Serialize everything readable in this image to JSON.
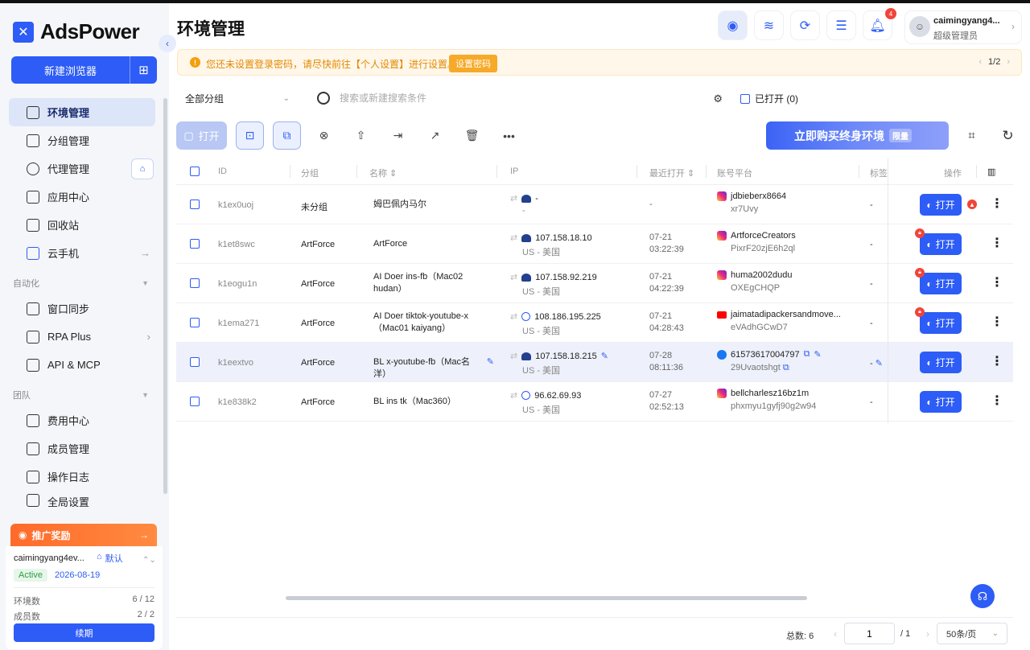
{
  "app": {
    "name": "AdsPower"
  },
  "sidebar": {
    "new_browser": "新建浏览器",
    "items": [
      {
        "label": "环境管理",
        "icon": "window-icon",
        "active": true
      },
      {
        "label": "分组管理",
        "icon": "folder-icon"
      },
      {
        "label": "代理管理",
        "icon": "globe-icon"
      },
      {
        "label": "应用中心",
        "icon": "puzzle-icon"
      },
      {
        "label": "回收站",
        "icon": "trash-icon"
      },
      {
        "label": "云手机",
        "icon": "cloud-phone-icon"
      }
    ],
    "section_automation": "自动化",
    "automation_items": [
      {
        "label": "窗口同步",
        "icon": "sync-icon"
      },
      {
        "label": "RPA Plus",
        "icon": "robot-icon"
      },
      {
        "label": "API & MCP",
        "icon": "api-icon"
      }
    ],
    "section_team": "团队",
    "team_items": [
      {
        "label": "费用中心",
        "icon": "wallet-icon"
      },
      {
        "label": "成员管理",
        "icon": "shield-user-icon"
      },
      {
        "label": "操作日志",
        "icon": "log-icon"
      },
      {
        "label": "全局设置",
        "icon": "settings-icon"
      }
    ],
    "promo": "推广奖励",
    "account": {
      "name": "caimingyang4ev...",
      "default_label": "默认",
      "status": "Active",
      "expiry": "2026-08-19",
      "env_label": "环境数",
      "env_value": "6 / 12",
      "member_label": "成员数",
      "member_value": "2 / 2",
      "renew": "续期"
    }
  },
  "header": {
    "title": "环境管理",
    "notification_count": "4",
    "user_name": "caimingyang4...",
    "user_role": "超级管理员"
  },
  "alert": {
    "text": "您还未设置登录密码，请尽快前往【个人设置】进行设置。",
    "button": "设置密码",
    "pager": "1/2"
  },
  "filters": {
    "group": "全部分组",
    "search_placeholder": "搜索或新建搜索条件",
    "opened": "已打开 (0)"
  },
  "toolbar": {
    "open": "打开",
    "buy_banner": "立即购买终身环境",
    "limited": "限量"
  },
  "table": {
    "columns": [
      "ID",
      "分组",
      "名称",
      "IP",
      "最近打开",
      "账号平台",
      "标签",
      "操作"
    ],
    "rows": [
      {
        "id": "k1ex0uoj",
        "group": "未分组",
        "name": "姆巴佩内马尔",
        "ip": "-",
        "loc": "-",
        "last1": "-",
        "last2": "",
        "platform": "ig",
        "account": "jdbieberx8664",
        "secret": "xr7Uvy",
        "tag": "-",
        "open": "打开",
        "lock": false,
        "warn": true,
        "ip_type": "flag"
      },
      {
        "id": "k1et8swc",
        "group": "ArtForce",
        "name": "ArtForce",
        "ip": "107.158.18.10",
        "loc": "US - 美国",
        "last1": "07-21",
        "last2": "03:22:39",
        "platform": "ig",
        "account": "ArtforceCreators",
        "secret": "PixrF20zjE6h2ql",
        "tag": "-",
        "open": "打开",
        "lock": true,
        "warn": false,
        "ip_type": "flag"
      },
      {
        "id": "k1eogu1n",
        "group": "ArtForce",
        "name": "AI Doer ins-fb（Mac02 hudan）",
        "ip": "107.158.92.219",
        "loc": "US - 美国",
        "last1": "07-21",
        "last2": "04:22:39",
        "platform": "ig",
        "account": "huma2002dudu",
        "secret": "OXEgCHQP",
        "tag": "-",
        "open": "打开",
        "lock": true,
        "warn": false,
        "ip_type": "flag"
      },
      {
        "id": "k1ema271",
        "group": "ArtForce",
        "name": "AI Doer tiktok-youtube-x（Mac01 kaiyang）",
        "ip": "108.186.195.225",
        "loc": "US - 美国",
        "last1": "07-21",
        "last2": "04:28:43",
        "platform": "yt",
        "account": "jaimatadipackersandmove...",
        "secret": "eVAdhGCwD7",
        "tag": "-",
        "open": "打开",
        "lock": true,
        "warn": false,
        "ip_type": "ip"
      },
      {
        "id": "k1eextvo",
        "group": "ArtForce",
        "name": "BL x-youtube-fb（Mac名洋）",
        "ip": "107.158.18.215",
        "loc": "US - 美国",
        "last1": "07-28",
        "last2": "08:11:36",
        "platform": "fb",
        "account": "61573617004797",
        "secret": "29Uvaotshgt",
        "tag": "-",
        "open": "打开",
        "lock": false,
        "warn": false,
        "ip_type": "flag",
        "highlight": true
      },
      {
        "id": "k1e838k2",
        "group": "ArtForce",
        "name": "BL ins tk（Mac360）",
        "ip": "96.62.69.93",
        "loc": "US - 美国",
        "last1": "07-27",
        "last2": "02:52:13",
        "platform": "ig",
        "account": "bellcharlesz16bz1m",
        "secret": "phxmyu1gyfj90g2w94",
        "tag": "-",
        "open": "打开",
        "lock": false,
        "warn": false,
        "ip_type": "ip"
      }
    ]
  },
  "footer": {
    "total": "总数: 6",
    "page": "1",
    "page_total": "/ 1",
    "page_size": "50条/页"
  },
  "colors": {
    "accent": "#2d5cf6",
    "alert": "#e28a00",
    "danger": "#f04438"
  }
}
